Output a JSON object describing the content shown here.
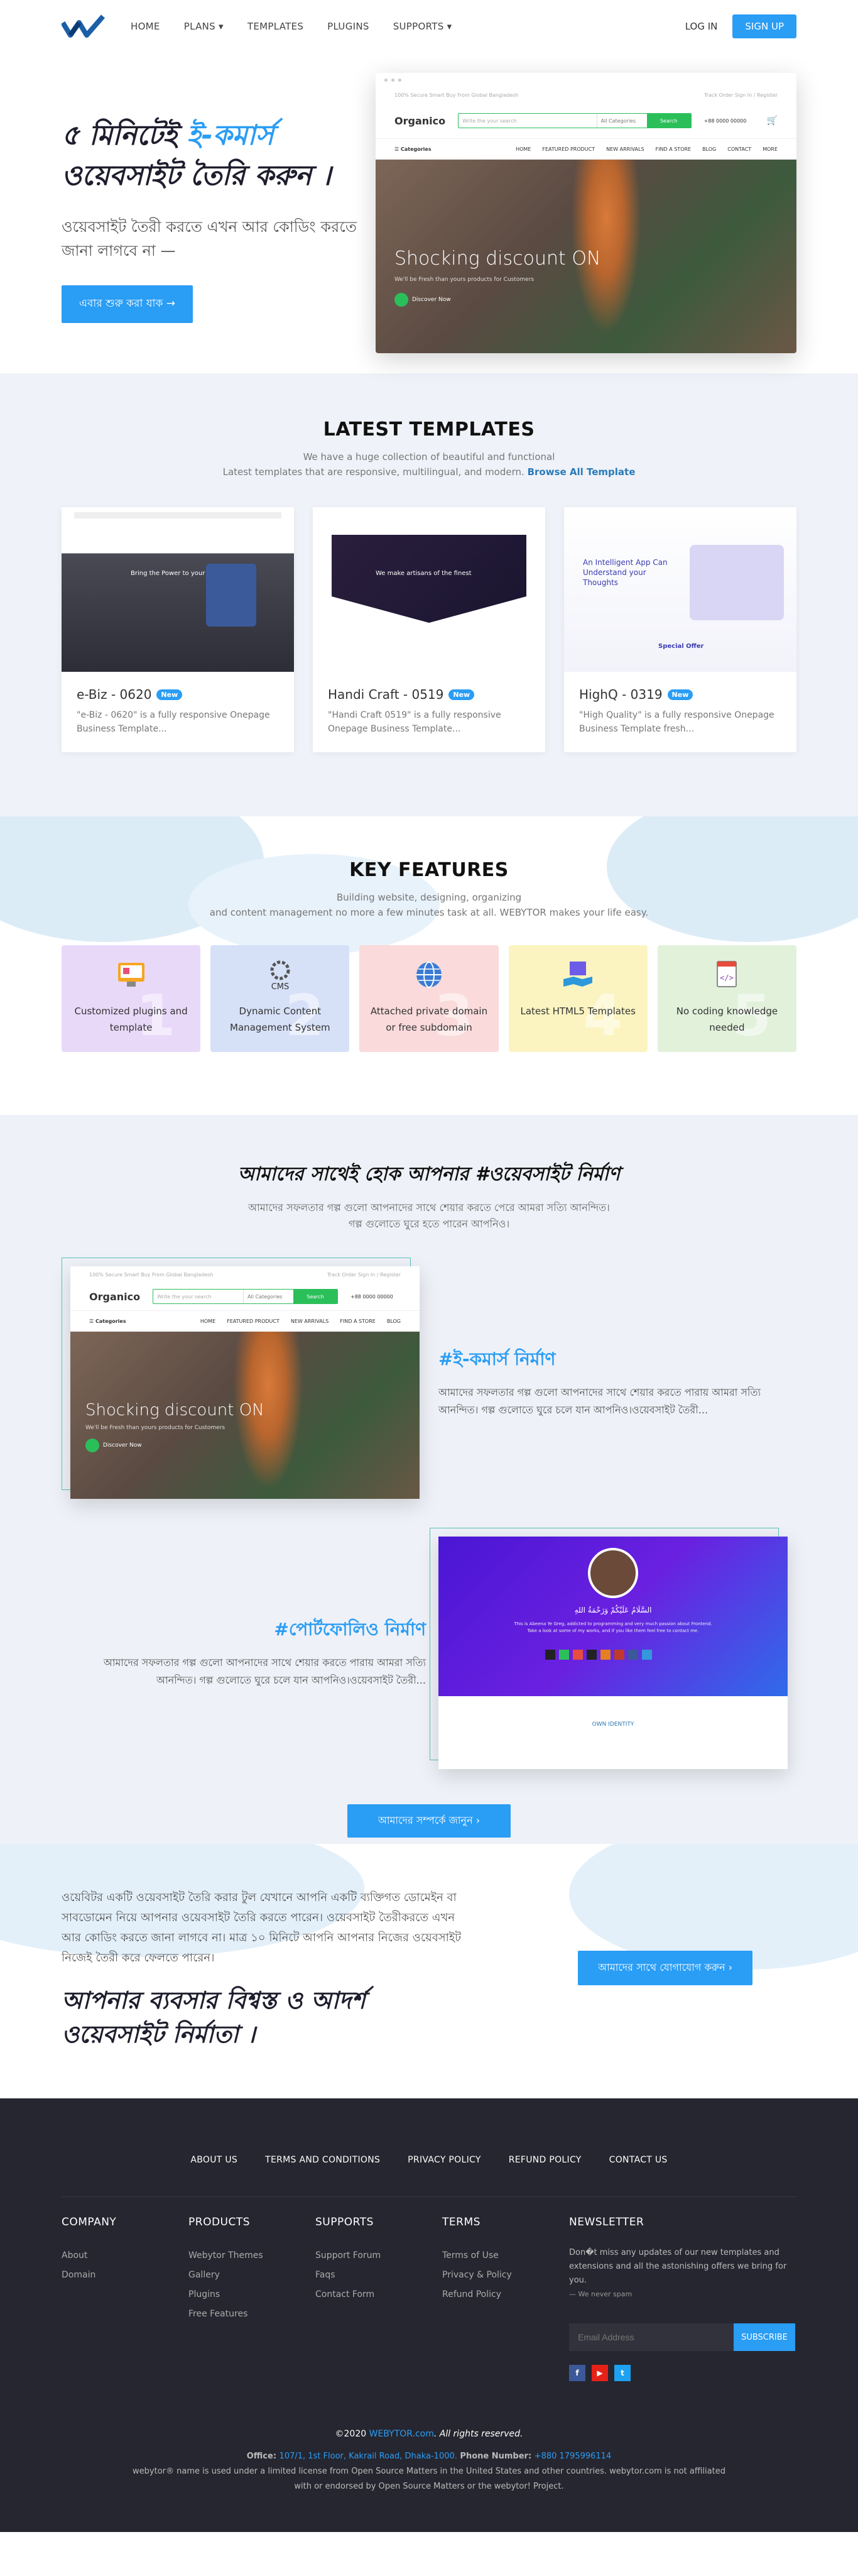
{
  "nav": {
    "items": [
      "HOME",
      "PLANS ▾",
      "TEMPLATES",
      "PLUGINS",
      "SUPPORTS ▾"
    ],
    "login": "LOG IN",
    "signup": "SIGN UP"
  },
  "hero": {
    "title_a": "৫ মিনিটেই ",
    "title_hl": "ই-কমার্স",
    "title_b": "ওয়েবসাইট তৈরি করুন ।",
    "subtitle": "ওয়েবসাইট তৈরী করতে এখন আর কোডিং করতে জানা লাগবে না —",
    "button": "এবার শুরু করা যাক →"
  },
  "mock": {
    "topbar_left": "100% Secure Smart Buy From Global Bangladesh",
    "topbar_right": "Track Order    Sign In / Register",
    "logo": "Organico",
    "search_placeholder": "Write the your search",
    "category": "All Categories",
    "search_btn": "Search",
    "contact": "+88 0000 00000",
    "categories": "Categories",
    "menu": [
      "HOME",
      "FEATURED PRODUCT",
      "NEW ARRIVALS",
      "FIND A STORE",
      "BLOG",
      "CONTACT",
      "MORE"
    ],
    "banner_title": "Shocking discount ON",
    "banner_sub": "We'll be Fresh than yours products for Customers",
    "banner_btn": "Discover Now"
  },
  "latest": {
    "title": "LATEST TEMPLATES",
    "desc_1": "We have a huge collection of beautiful and functional",
    "desc_2": "Latest templates that are responsive, multilingual, and modern.",
    "browse": "Browse All Template",
    "badge": "New",
    "cards": [
      {
        "title": "e-Biz - 0620",
        "desc": "\"e-Biz - 0620\" is a fully responsive Onepage Business Template..."
      },
      {
        "title": "Handi Craft - 0519",
        "desc": "\"Handi Craft 0519\" is a fully responsive Onepage Business Template..."
      },
      {
        "title": "HighQ - 0319",
        "desc": "\"High Quality\" is a fully responsive Onepage Business Template fresh..."
      }
    ],
    "thumb_text": [
      "Bring the Power to your Friday",
      "We make artisans of the finest",
      "An Intelligent App Can Understand your Thoughts"
    ],
    "thumb_sub": [
      "Special Offer"
    ]
  },
  "features": {
    "title": "KEY FEATURES",
    "desc_1": "Building website, designing, organizing",
    "desc_2": "and content management no more a few minutes task at all. WEBYTOR makes your life easy.",
    "items": [
      {
        "label": "Customized plugins and template",
        "num": "1",
        "bg": "#e9d9f9",
        "icon": "plugins-icon"
      },
      {
        "label": "Dynamic Content Management System",
        "num": "2",
        "bg": "#d6e1f8",
        "icon": "cms-icon"
      },
      {
        "label": "Attached private domain or free subdomain",
        "num": "3",
        "bg": "#fadada",
        "icon": "globe-icon"
      },
      {
        "label": "Latest HTML5 Templates",
        "num": "4",
        "bg": "#fbf4c1",
        "icon": "html5-icon"
      },
      {
        "label": "No coding knowledge needed",
        "num": "5",
        "bg": "#e1f1da",
        "icon": "code-icon"
      }
    ],
    "cms_text": "CMS"
  },
  "build": {
    "title": "আমাদের সাথেই হোক আপনার #ওয়েবসাইট নির্মাণ",
    "desc_1": "আমাদের সফলতার গল্প গুলো আপনাদের সাথে শেয়ার করতে পেরে আমরা সত্যি আনন্দিত।",
    "desc_2": "গল্প গুলোতে ঘুরে হতে পারেন আপনিও।",
    "ecom_title": "#ই-কমার্স নির্মাণ",
    "ecom_desc": "আমাদের সফলতার গল্প গুলো আপনাদের সাথে শেয়ার করতে পারায় আমরা সত্যি আনন্দিত। গল্প গুলোতে ঘুরে চলে যান আপনিও।ওয়েবসাইট তৈরী...",
    "port_title": "#পোর্টফোলিও নির্মাণ",
    "port_desc": "আমাদের সফলতার গল্প গুলো আপনাদের সাথে শেয়ার করতে পারায় আমরা সত্যি আনন্দিত। গল্প গুলোতে ঘুরে চলে যান আপনিও।ওয়েবসাইট তৈরী...",
    "port_greeting": "السَّلَامُ عَلَيْكُمْ وَرَحْمَةُ اللهِ",
    "port_intro": "This is Abeena Ye Greg, addicted to programming and very much passion about Frontend. Take a look at some of my works, and if you like them feel free to contact me.",
    "port_section": "OWN IDENTITY",
    "button": "আমাদের সম্পর্কে জানুন ›"
  },
  "cta": {
    "para": "ওয়েবিটর একটি ওয়েবসাইট তৈরি করার টুল যেখানে আপনি একটি ব্যক্তিগত ডোমেইন বা সাবডোমেন নিয়ে আপনার ওয়েবসাইট তৈরি করতে পারেন। ওয়েবসাইট তৈরীকরতে এখন আর কোডিং করতে জানা লাগবে না। মাত্র ১০ মিনিটে আপনি আপনার নিজের ওয়েবসাইট নিজেই তৈরী করে ফেলতে পারেন।",
    "heading": "আপনার ব্যবসার বিশ্বস্ত ও আদর্শ ওয়েবসাইট নির্মাতা ।",
    "button": "আমাদের সাথে যোগাযোগ করুন ›"
  },
  "footer": {
    "links": [
      "ABOUT US",
      "TERMS AND CONDITIONS",
      "PRIVACY POLICY",
      "REFUND POLICY",
      "CONTACT US"
    ],
    "cols": [
      {
        "title": "COMPANY",
        "items": [
          "About",
          "Domain"
        ]
      },
      {
        "title": "PRODUCTS",
        "items": [
          "Webytor Themes",
          "Gallery",
          "Plugins",
          "Free Features"
        ]
      },
      {
        "title": "SUPPORTS",
        "items": [
          "Support Forum",
          "Faqs",
          "Contact Form"
        ]
      },
      {
        "title": "TERMS",
        "items": [
          "Terms of Use",
          "Privacy & Policy",
          "Refund Policy"
        ]
      }
    ],
    "newsletter_title": "NEWSLETTER",
    "newsletter_text": "Don�t miss any updates of our new templates and extensions and all the astonishing offers we bring for you.",
    "newsletter_note": "— We never spam",
    "email_placeholder": "Email Address",
    "subscribe": "SUBSCRIBE",
    "social": [
      "f",
      "▶",
      "t"
    ],
    "copy_pre": "©2020 ",
    "copy_link": "WEBYTOR.com",
    "copy_post": ". All rights reserved.",
    "office_label": "Office: ",
    "office_addr": "107/1, 1st Floor, Kakrail Road, Dhaka-1000.",
    "phone_label": " Phone Number: ",
    "phone": "+880 1795996114",
    "license_1": "webytor® name is used under a limited license from Open Source Matters in the United States and other countries. webytor.com is not affiliated",
    "license_2": "with or endorsed by Open Source Matters or the webytor! Project."
  },
  "colors": {
    "accent": "#2a9df4",
    "footer_bg": "#262630",
    "section_bg": "#eff2f8",
    "green": "#2bbf5a"
  }
}
